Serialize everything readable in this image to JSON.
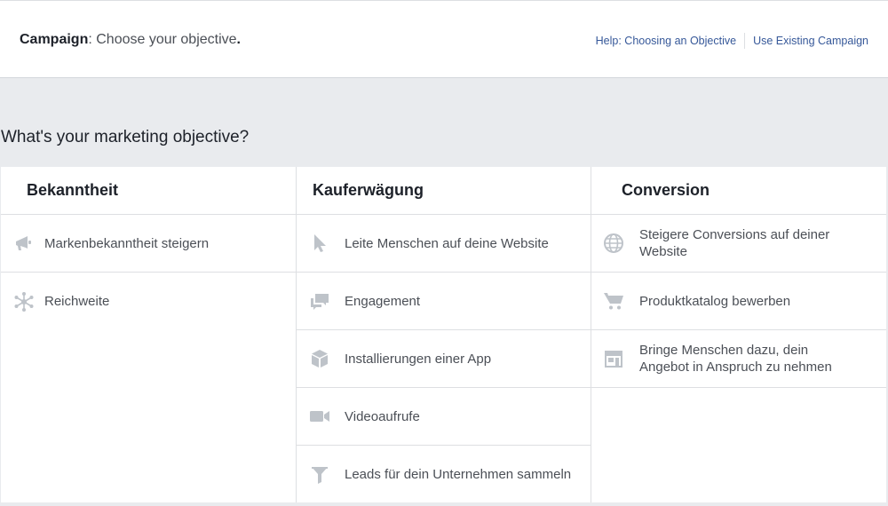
{
  "header": {
    "title_bold": "Campaign",
    "title_rest": ": Choose your objective",
    "title_dot": ".",
    "help_link": "Help: Choosing an Objective",
    "existing_link": "Use Existing Campaign"
  },
  "question": "What's your marketing objective?",
  "colors": {
    "icon": "#bec3c9",
    "link": "#365899",
    "border": "#dddfe2",
    "background": "#e9ebee"
  },
  "columns": [
    {
      "title": "Bekanntheit",
      "items": [
        {
          "label": "Markenbekanntheit steigern",
          "icon": "megaphone-icon"
        },
        {
          "label": "Reichweite",
          "icon": "reach-icon"
        }
      ]
    },
    {
      "title": "Kauferwägung",
      "items": [
        {
          "label": "Leite Menschen auf deine Website",
          "icon": "cursor-icon"
        },
        {
          "label": "Engagement",
          "icon": "chat-bubbles-icon"
        },
        {
          "label": "Installierungen einer App",
          "icon": "box-icon"
        },
        {
          "label": "Videoaufrufe",
          "icon": "video-camera-icon"
        },
        {
          "label": "Leads für dein Unternehmen sammeln",
          "icon": "funnel-icon"
        }
      ]
    },
    {
      "title": "Conversion",
      "items": [
        {
          "label_line1": "Steigere Conversions auf deiner",
          "label_line2": "Website",
          "icon": "globe-icon"
        },
        {
          "label": "Produktkatalog bewerben",
          "icon": "cart-icon"
        },
        {
          "label_line1": "Bringe Menschen dazu, dein",
          "label_line2": "Angebot in Anspruch zu nehmen",
          "icon": "store-icon"
        }
      ]
    }
  ]
}
